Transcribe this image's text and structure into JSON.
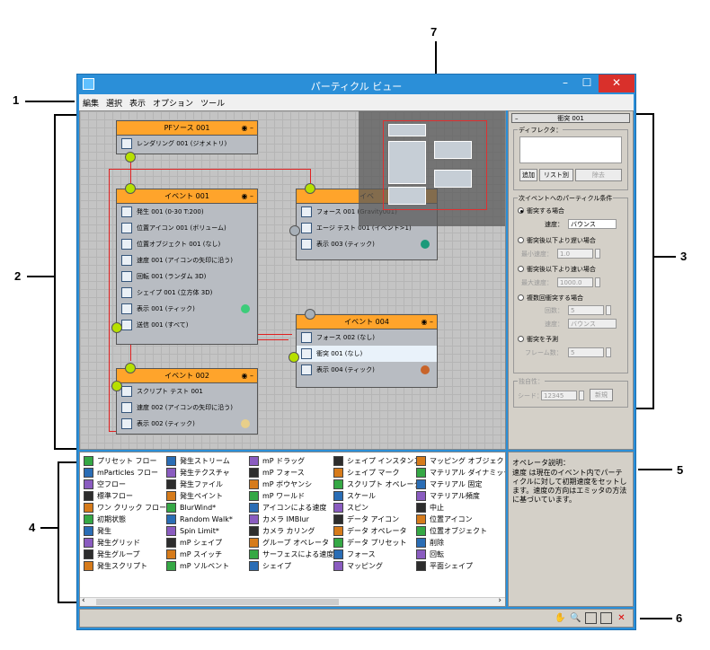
{
  "annotations": [
    "1",
    "2",
    "3",
    "4",
    "5",
    "6",
    "7"
  ],
  "window": {
    "title": "パーティクル ビュー",
    "minimize": "–",
    "maximize": "☐",
    "close": "✕"
  },
  "menu": [
    "編集",
    "選択",
    "表示",
    "オプション",
    "ツール"
  ],
  "nodes": {
    "pf_source": {
      "title": "PFソース 001",
      "ops": [
        "レンダリング 001 (ジオメトリ)"
      ]
    },
    "event001": {
      "title": "イベント 001",
      "ops": [
        "発生 001 (0-30 T:200)",
        "位置アイコン 001 (ボリューム)",
        "位置オブジェクト 001 (なし)",
        "速度 001 (アイコンの矢印に沿う)",
        "回転 001 (ランダム 3D)",
        "シェイプ 001 (立方体 3D)",
        "表示 001 (ティック)",
        "送信 001 (すべて)"
      ]
    },
    "event002": {
      "title": "イベント 002",
      "ops": [
        "スクリプト テスト 001",
        "速度 002 (アイコンの矢印に沿う)",
        "表示 002 (ティック)"
      ]
    },
    "event003": {
      "title": "イベ",
      "ops": [
        "フォース 001 (Gravity001)",
        "エージ テスト 001 (イベント>1)",
        "表示 003 (ティック)"
      ]
    },
    "event004": {
      "title": "イベント 004",
      "ops": [
        "フォース 002 (なし)",
        "衝突 001 (なし)",
        "表示 004 (ティック)"
      ]
    }
  },
  "panel": {
    "title": "衝突 001",
    "collapse": "–",
    "deflectors_label": "ディフレクタ：",
    "btn_add": "追加",
    "btn_list": "リスト別",
    "btn_remove": "除去",
    "condition_label": "次イベントへのパーティクル条件",
    "opt1": "衝突する場合",
    "speed_label": "速度：",
    "speed_value": "バウンス",
    "opt2": "衝突後以下より遅い場合",
    "min_speed_label": "最小速度：",
    "min_speed_value": "1.0",
    "opt3": "衝突後以下より速い場合",
    "max_speed_label": "最大速度：",
    "max_speed_value": "1000.0",
    "opt4": "複数回衝突する場合",
    "count_label": "回数：",
    "count_value": "5",
    "speed2_label": "速度：",
    "speed2_value": "バウンス",
    "opt5": "衝突を予測",
    "frames_label": "フレーム数：",
    "frames_value": "5",
    "uniq_label": "独自性：",
    "seed_label": "シード：",
    "seed_value": "12345",
    "new_btn": "新規"
  },
  "depot": {
    "col1": [
      "プリセット フロー",
      "mParticles フロー",
      "空フロー",
      "標準フロー",
      "ワン クリック フロー",
      "初期状態",
      "発生",
      "発生グリッド",
      "発生グループ",
      "発生スクリプト"
    ],
    "col2": [
      "発生ストリーム",
      "発生テクスチャ",
      "発生ファイル",
      "発生ペイント",
      "BlurWind*",
      "Random Walk*",
      "Spin Limit*",
      "mP シェイプ",
      "mP スイッチ",
      "mP ソルベント"
    ],
    "col3": [
      "mP ドラッグ",
      "mP フォース",
      "mP ボウヤンシ",
      "mP ワールド",
      "アイコンによる速度",
      "カメラ IMBlur",
      "カメラ カリング",
      "グループ オペレータ",
      "サーフェスによる速度",
      "シェイプ"
    ],
    "col4": [
      "シェイプ インスタンス",
      "シェイプ マーク",
      "スクリプト オペレータ",
      "スケール",
      "スピン",
      "データ アイコン",
      "データ オペレータ",
      "データ プリセット",
      "フォース",
      "マッピング"
    ],
    "col5": [
      "マッピング オブジェクト",
      "マテリアル ダイナミック",
      "マテリアル 固定",
      "マテリアル頻度",
      "中止",
      "位置アイコン",
      "位置オブジェクト",
      "削除",
      "回転",
      "平面シェイプ"
    ]
  },
  "description": {
    "label": "オペレータ説明：",
    "text": "速度 は現在のイベント内でパーティクルに対して初期速度をセットします。速度の方向はエミッタの方法に基づいています。"
  },
  "colors": {
    "event_header": "#ffa42b",
    "window_frame": "#2b8fd8",
    "port_green": "#b7e000",
    "wire": "#e02020",
    "display_green": "#3dcc7a",
    "display_teal": "#1a9a7a",
    "display_orange": "#c8642a",
    "display_cream": "#e8cf8a"
  },
  "status_icons": [
    "hand-icon",
    "zoom-icon",
    "zoom-region-icon",
    "zoom-extents-icon",
    "no-zoom-icon"
  ]
}
